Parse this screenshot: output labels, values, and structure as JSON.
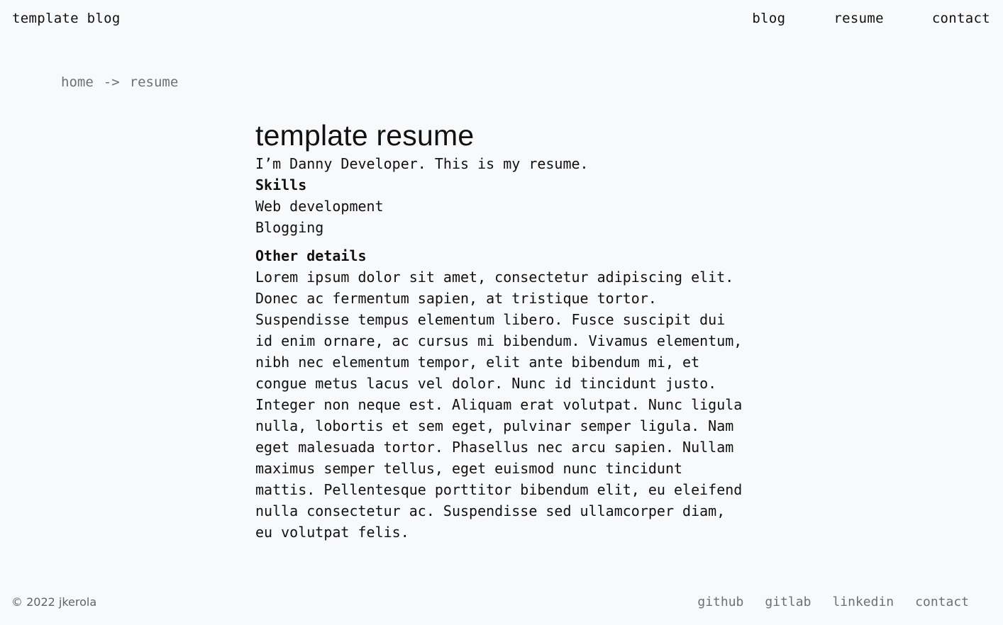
{
  "header": {
    "site_title": "template blog",
    "nav": [
      "blog",
      "resume",
      "contact"
    ]
  },
  "breadcrumb": {
    "home": "home",
    "separator": "->",
    "current": "resume"
  },
  "main": {
    "title": "template resume",
    "intro": "I’m Danny Developer. This is my resume.",
    "skills_heading": "Skills",
    "skills": [
      "Web development",
      "Blogging"
    ],
    "other_heading": "Other details",
    "other_text": "Lorem ipsum dolor sit amet, consectetur adipiscing elit. Donec ac fermentum sapien, at tristique tortor. Suspendisse tempus elementum libero. Fusce suscipit dui id enim ornare, ac cursus mi bibendum. Vivamus elementum, nibh nec elementum tempor, elit ante bibendum mi, et congue metus lacus vel dolor. Nunc id tincidunt justo. Integer non neque est. Aliquam erat volutpat. Nunc ligula nulla, lobortis et sem eget, pulvinar semper ligula. Nam eget malesuada tortor. Phasellus nec arcu sapien. Nullam maximus semper tellus, eget euismod nunc tincidunt mattis. Pellentesque porttitor bibendum elit, eu eleifend nulla consectetur ac. Suspendisse sed ullamcorper diam, eu volutpat felis."
  },
  "footer": {
    "copyright": "© 2022 jkerola",
    "links": [
      "github",
      "gitlab",
      "linkedin",
      "contact"
    ]
  }
}
